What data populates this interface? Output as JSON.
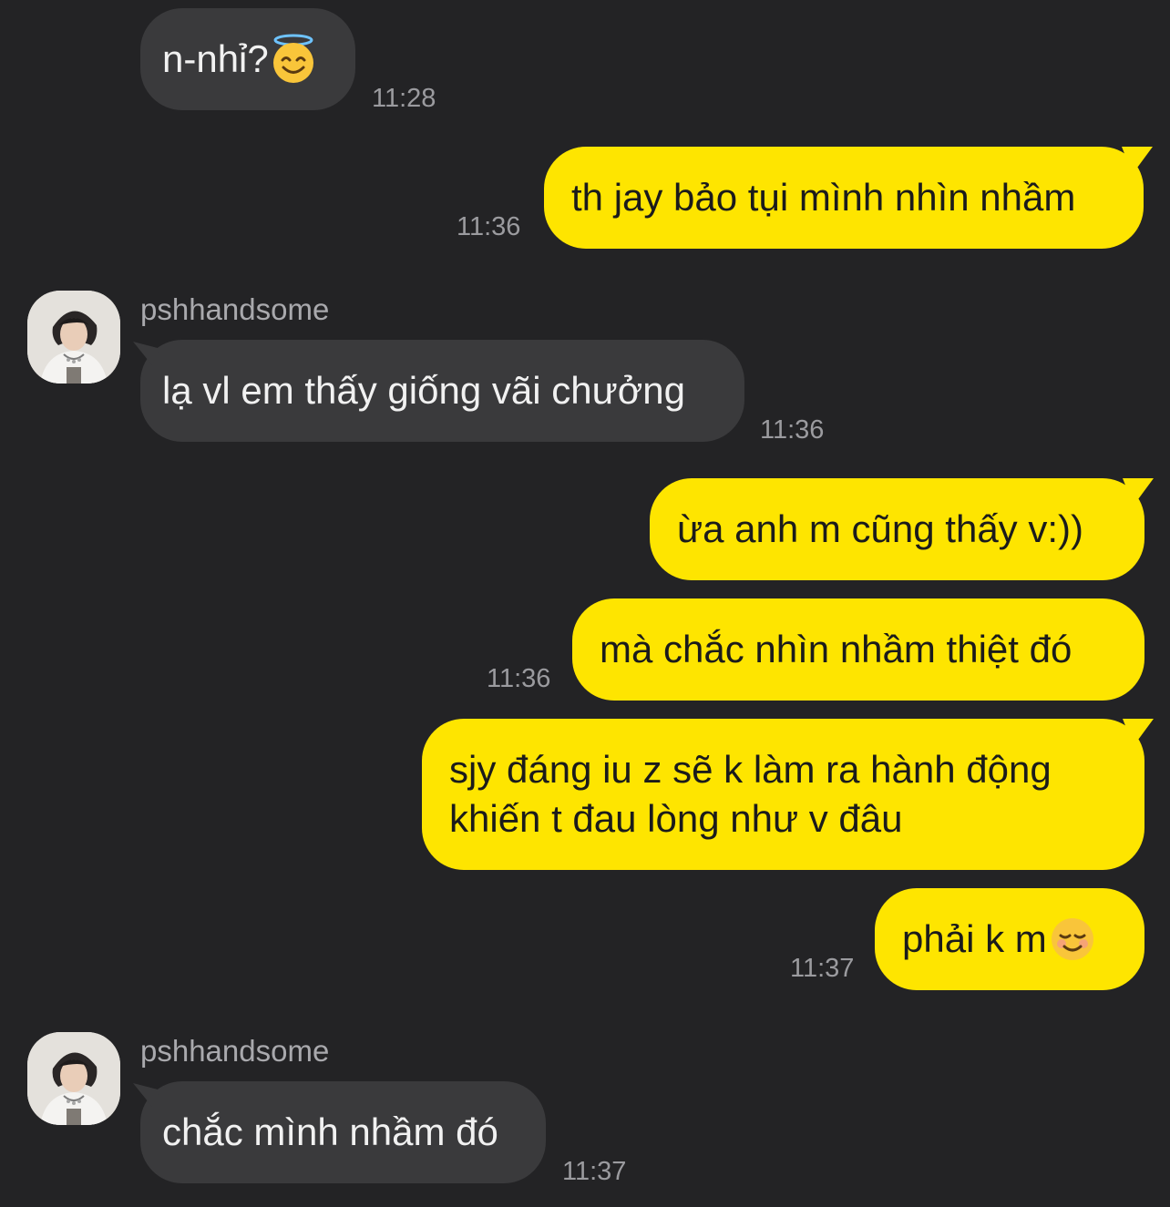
{
  "messages": {
    "m1": {
      "text": "n-nhỉ?",
      "emoji": "smiling-face-with-halo-icon",
      "time": "11:28"
    },
    "m2": {
      "text": "th jay bảo tụi mình nhìn nhầm",
      "time": "11:36"
    },
    "m3": {
      "sender": "pshhandsome",
      "text": "lạ vl em thấy giống vãi chưởng",
      "time": "11:36"
    },
    "m4": {
      "text": "ừa anh m cũng thấy v:))"
    },
    "m5": {
      "text": "mà chắc nhìn nhầm thiệt đó",
      "time": "11:36"
    },
    "m6": {
      "line1": "sjy đáng iu z sẽ k làm ra hành động",
      "line2": "khiến t đau lòng như v đâu"
    },
    "m7": {
      "text": "phải k m",
      "emoji": "smiling-face-icon",
      "time": "11:37"
    },
    "m8": {
      "sender": "pshhandsome",
      "text": "chắc mình nhầm đó",
      "time": "11:37"
    }
  },
  "colors": {
    "background": "#232325",
    "incoming_bubble": "#3a3a3c",
    "outgoing_bubble": "#fee500"
  }
}
